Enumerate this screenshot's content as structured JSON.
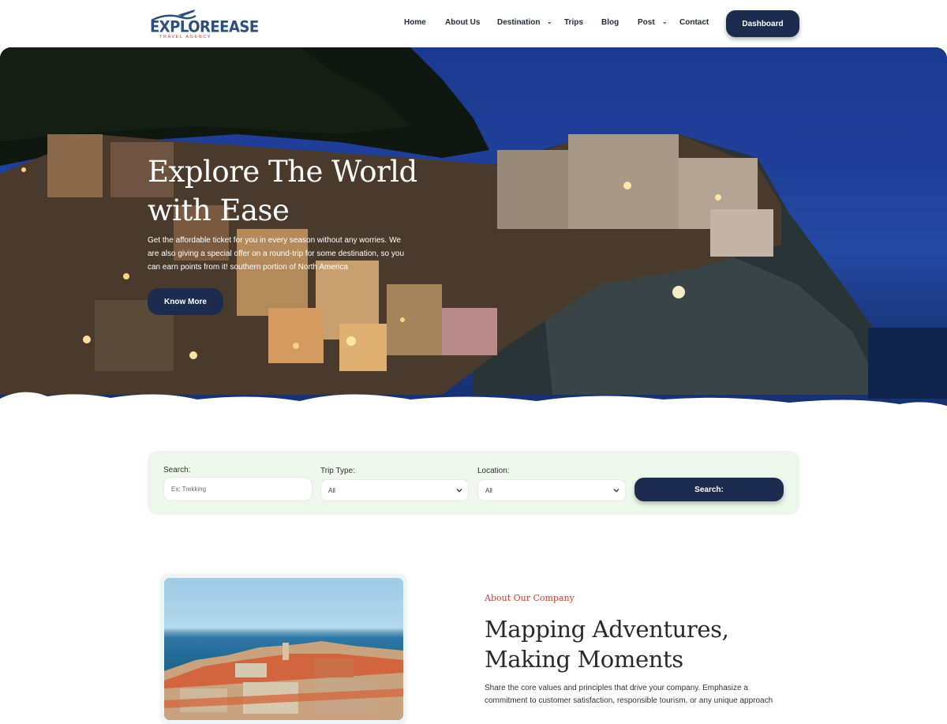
{
  "brand": {
    "name": "EXPLOREEASE",
    "tagline": "TRAVEL AGENCY"
  },
  "nav": {
    "items": [
      {
        "label": "Home",
        "dropdown": false
      },
      {
        "label": "About Us",
        "dropdown": false
      },
      {
        "label": "Destination",
        "dropdown": true
      },
      {
        "label": "Trips",
        "dropdown": false
      },
      {
        "label": "Blog",
        "dropdown": false
      },
      {
        "label": "Post",
        "dropdown": true
      },
      {
        "label": "Contact",
        "dropdown": false
      }
    ],
    "dashboard_label": "Dashboard"
  },
  "hero": {
    "title_line1": "Explore The World",
    "title_line2": "with Ease",
    "text": "Get the affordable ticket for you in every season without any worries. We are also giving a special offer on a round-trip for some destination, so you can earn points from it! southern portion of North America",
    "button_label": "Know More"
  },
  "search": {
    "search_label": "Search:",
    "search_placeholder": "Ex: Trekking",
    "trip_type_label": "Trip Type:",
    "trip_type_value": "All",
    "location_label": "Location:",
    "location_value": "All",
    "button_label": "Search:"
  },
  "about": {
    "kicker": "About Our Company",
    "title_line1": "Mapping Adventures,",
    "title_line2": "Making Moments",
    "text": "Share the core values and principles that drive your company. Emphasize a commitment to customer satisfaction, responsible tourism, or any unique approach"
  },
  "colors": {
    "primary": "#1b2c4f",
    "accent": "#d63b2f",
    "panel": "#eef7ec",
    "logo": "#2d4f7c"
  },
  "icons": [
    "plane-icon",
    "chevron-down-icon"
  ]
}
